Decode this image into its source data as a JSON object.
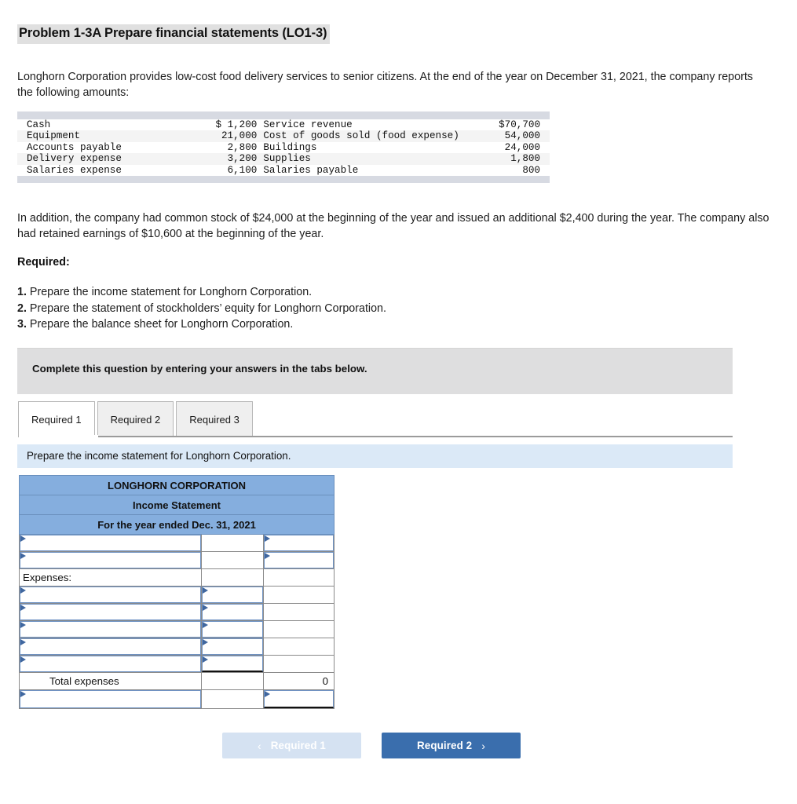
{
  "problem": {
    "title": "Problem 1-3A Prepare financial statements (LO1-3)",
    "intro": "Longhorn Corporation provides low-cost food delivery services to senior citizens. At the end of the year on December 31, 2021, the company reports the following amounts:",
    "addition": "In addition, the company had common stock of $24,000 at the beginning of the year and issued an additional $2,400 during the year. The company also had retained earnings of $10,600 at the beginning of the year."
  },
  "amounts_table": {
    "rows": [
      {
        "label1": "Cash",
        "value1": "$ 1,200",
        "label2": "Service revenue",
        "value2": "$70,700"
      },
      {
        "label1": "Equipment",
        "value1": "21,000",
        "label2": "Cost of goods sold (food expense)",
        "value2": "54,000"
      },
      {
        "label1": "Accounts payable",
        "value1": "2,800",
        "label2": "Buildings",
        "value2": "24,000"
      },
      {
        "label1": "Delivery expense",
        "value1": "3,200",
        "label2": "Supplies",
        "value2": "1,800"
      },
      {
        "label1": "Salaries expense",
        "value1": "6,100",
        "label2": "Salaries payable",
        "value2": "800"
      }
    ]
  },
  "required": {
    "heading": "Required:",
    "items": [
      {
        "num": "1.",
        "text": " Prepare the income statement for Longhorn Corporation."
      },
      {
        "num": "2.",
        "text": " Prepare the statement of stockholders’ equity for Longhorn Corporation."
      },
      {
        "num": "3.",
        "text": " Prepare the balance sheet for Longhorn Corporation."
      }
    ]
  },
  "banner": {
    "text": "Complete this question by entering your answers in the tabs below."
  },
  "tabs": [
    {
      "label": "Required 1",
      "active": true
    },
    {
      "label": "Required 2",
      "active": false
    },
    {
      "label": "Required 3",
      "active": false
    }
  ],
  "sub_instruction": {
    "text": "Prepare the income statement for Longhorn Corporation."
  },
  "worksheet": {
    "header_lines": [
      "LONGHORN CORPORATION",
      "Income Statement",
      "For the year ended Dec. 31, 2021"
    ],
    "rows": [
      {
        "type": "input3",
        "label": "",
        "col2": "",
        "col3": ""
      },
      {
        "type": "input3",
        "label": "",
        "col2": "",
        "col3": ""
      },
      {
        "type": "static",
        "label": "Expenses:",
        "col2": "",
        "col3": ""
      },
      {
        "type": "input12",
        "label": "",
        "col2": "",
        "col3": ""
      },
      {
        "type": "input12",
        "label": "",
        "col2": "",
        "col3": ""
      },
      {
        "type": "input12",
        "label": "",
        "col2": "",
        "col3": ""
      },
      {
        "type": "input12",
        "label": "",
        "col2": "",
        "col3": ""
      },
      {
        "type": "input12",
        "label": "",
        "col2": "",
        "col3": ""
      },
      {
        "type": "total",
        "label": "Total expenses",
        "col2": "",
        "col3": "0"
      },
      {
        "type": "final",
        "label": "",
        "col2": "",
        "col3": ""
      }
    ]
  },
  "nav": {
    "prev_label": "Required 1",
    "prev_chevron": "‹",
    "next_label": "Required 2",
    "next_chevron": "›"
  },
  "colors": {
    "header_blue": "#85aede",
    "instruction_blue": "#dbe9f7",
    "banner_grey": "#dededf",
    "button_blue": "#3a6ead",
    "button_disabled": "#d5e2f2",
    "input_border": "#6f93c4"
  }
}
